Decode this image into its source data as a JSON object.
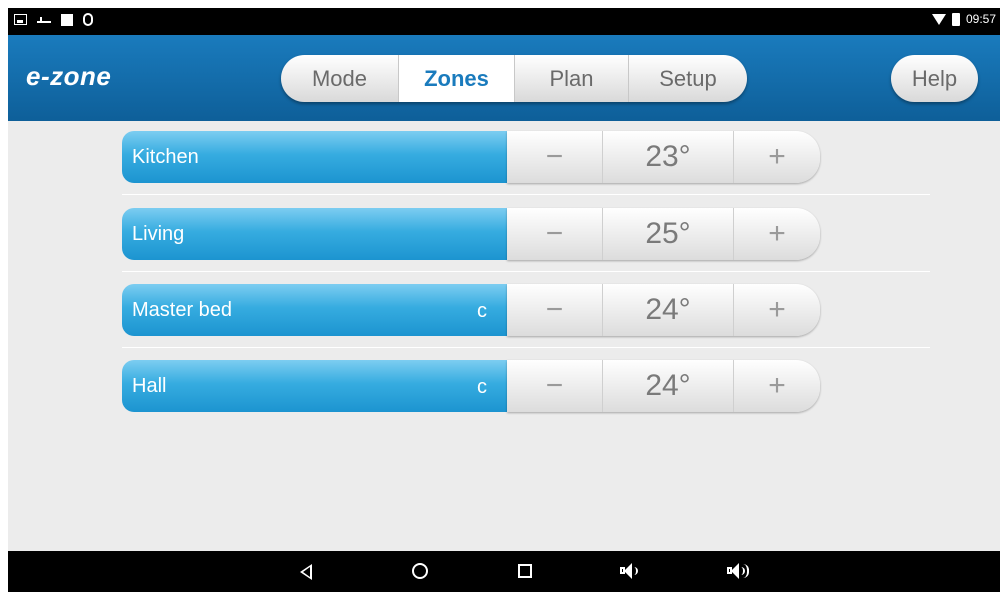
{
  "status_bar": {
    "time": "09:57",
    "left_icons": [
      "image-icon",
      "usb-icon",
      "square-icon",
      "debug-icon"
    ],
    "right_icons": [
      "wifi-icon",
      "battery-icon"
    ]
  },
  "app": {
    "logo": "e-zone",
    "brand_color": "#1a7bbd"
  },
  "tabs": [
    {
      "label": "Mode",
      "active": false
    },
    {
      "label": "Zones",
      "active": true
    },
    {
      "label": "Plan",
      "active": false
    },
    {
      "label": "Setup",
      "active": false
    }
  ],
  "help_label": "Help",
  "zones": [
    {
      "name": "Kitchen",
      "flag": "",
      "minus": "−",
      "temp": "23°",
      "plus": "+"
    },
    {
      "name": "Living",
      "flag": "",
      "minus": "−",
      "temp": "25°",
      "plus": "+"
    },
    {
      "name": "Master bed",
      "flag": "c",
      "minus": "−",
      "temp": "24°",
      "plus": "+"
    },
    {
      "name": "Hall",
      "flag": "c",
      "minus": "−",
      "temp": "24°",
      "plus": "+"
    }
  ],
  "nav_bar": {
    "icons": [
      "back-icon",
      "home-icon",
      "recents-icon",
      "volume-down-icon",
      "volume-up-icon"
    ]
  }
}
